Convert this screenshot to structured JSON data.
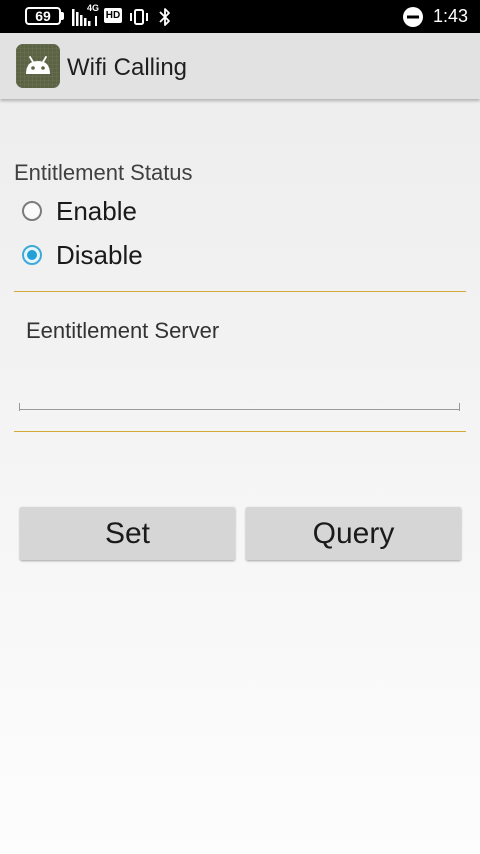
{
  "status_bar": {
    "battery": "69",
    "network": "4G",
    "hd": "HD",
    "time": "1:43"
  },
  "app_bar": {
    "title": "Wifi Calling"
  },
  "entitlement": {
    "label": "Entitlement Status",
    "options": [
      {
        "label": "Enable",
        "checked": false
      },
      {
        "label": "Disable",
        "checked": true
      }
    ]
  },
  "server": {
    "label": "Eentitlement Server",
    "value": ""
  },
  "buttons": {
    "set": "Set",
    "query": "Query"
  },
  "colors": {
    "accent": "#24a0d8",
    "divider": "#d5a839"
  }
}
